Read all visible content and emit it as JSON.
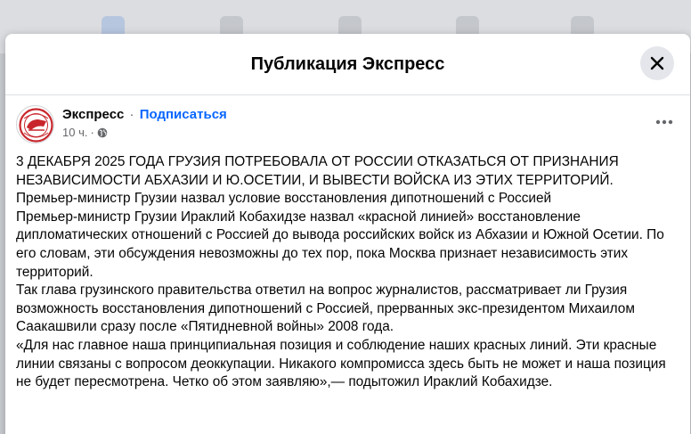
{
  "modal": {
    "title": "Публикация Экспресс",
    "close_icon": "close-icon"
  },
  "post": {
    "author": "Экспресс",
    "separator": "·",
    "subscribe_label": "Подписаться",
    "time": "10 ч.",
    "dot": "·",
    "privacy_icon": "globe-icon",
    "more_icon": "more-horizontal-icon",
    "avatar_text": "ЭКСПРЕСС",
    "colors": {
      "accent": "#0866ff",
      "logo": "#c8262c"
    },
    "paragraphs": [
      "3 ДЕКАБРЯ 2025 ГОДА ГРУЗИЯ ПОТРЕБОВАЛА ОТ РОССИИ ОТКАЗАТЬСЯ ОТ ПРИЗНАНИЯ НЕЗАВИСИМОСТИ АБХАЗИИ И Ю.ОСЕТИИ, И ВЫВЕСТИ ВОЙСКА ИЗ ЭТИХ ТЕРРИТОРИЙ.",
      "Премьер-министр Грузии назвал условие восстановления дипотношений с Россией",
      "Премьер-министр Грузии Ираклий Кобахидзе назвал «красной линией» восстановление дипломатических отношений с Россией до вывода российских войск из Абхазии и Южной Осетии. По его словам, эти обсуждения невозможны до тех пор, пока Москва признает независимость этих территорий.",
      "Так глава грузинского правительства ответил на вопрос журналистов, рассматривает ли Грузия возможность восстановления дипотношений с Россией, прерванных экс-президентом Михаилом Саакашвили сразу после «Пятидневной войны» 2008 года.",
      "«Для нас главное наша принципиальная позиция и соблюдение наших красных линий. Эти красные линии связаны с вопросом деоккупации. Никакого компромисса здесь быть не может и наша позиция не будет пересмотрена. Четко об этом заявляю»,— подытожил Ираклий Кобахидзе."
    ]
  }
}
